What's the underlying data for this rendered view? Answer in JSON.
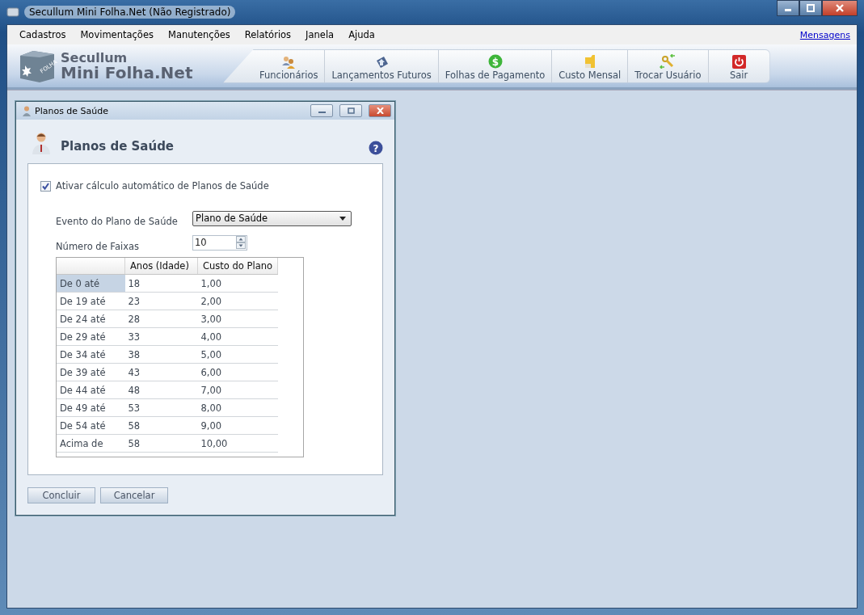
{
  "window": {
    "title": "Secullum Mini Folha.Net (Não Registrado)"
  },
  "menu": [
    "Cadastros",
    "Movimentações",
    "Manutenções",
    "Relatórios",
    "Janela",
    "Ajuda"
  ],
  "messages_link": "Mensagens",
  "logo": {
    "line_1": "Secullum",
    "line_2": "Mini Folha.Net",
    "badge": "FOLHA"
  },
  "coin_glyph": "$",
  "help_glyph": "?",
  "toolbar": [
    "Funcionários",
    "Lançamentos Futuros",
    "Folhas de Pagamento",
    "Custo Mensal",
    "Trocar Usuário",
    "Sair"
  ],
  "dialog": {
    "title": "Planos de Saúde",
    "heading": "Planos de Saúde",
    "auto_calc": {
      "label": "Ativar cálculo automático de Planos de Saúde",
      "checked": true
    },
    "event": {
      "label": "Evento do Plano de Saúde",
      "value": "Plano de Saúde"
    },
    "bands": {
      "label": "Número de Faixas",
      "value": "10"
    },
    "table": {
      "columns": [
        "Anos (Idade)",
        "Custo do Plano"
      ],
      "rows": [
        {
          "range": "De 0 até",
          "age": "18",
          "cost": "1,00",
          "selected": true
        },
        {
          "range": "De 19 até",
          "age": "23",
          "cost": "2,00",
          "selected": false
        },
        {
          "range": "De 24 até",
          "age": "28",
          "cost": "3,00",
          "selected": false
        },
        {
          "range": "De 29 até",
          "age": "33",
          "cost": "4,00",
          "selected": false
        },
        {
          "range": "De 34 até",
          "age": "38",
          "cost": "5,00",
          "selected": false
        },
        {
          "range": "De 39 até",
          "age": "43",
          "cost": "6,00",
          "selected": false
        },
        {
          "range": "De 44 até",
          "age": "48",
          "cost": "7,00",
          "selected": false
        },
        {
          "range": "De 49 até",
          "age": "53",
          "cost": "8,00",
          "selected": false
        },
        {
          "range": "De 54 até",
          "age": "58",
          "cost": "9,00",
          "selected": false
        },
        {
          "range": "Acima de",
          "age": "58",
          "cost": "10,00",
          "selected": false
        }
      ]
    },
    "buttons": [
      "Concluir",
      "Cancelar"
    ]
  }
}
